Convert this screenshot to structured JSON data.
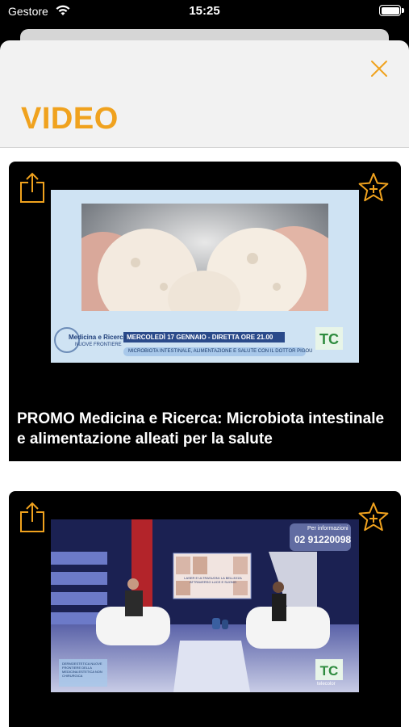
{
  "status_bar": {
    "carrier": "Gestore",
    "time": "15:25"
  },
  "header": {
    "title": "VIDEO"
  },
  "videos": [
    {
      "title": "PROMO Medicina e Ricerca: Microbiota intestinale e alimentazione alleati per la salute",
      "thumbnail": {
        "program": "Medicina e Ricerca",
        "program_sub": "NUOVE FRONTIERE",
        "date_banner": "MERCOLEDÌ 17 GENNAIO - DIRETTA ORE 21.00",
        "ticker": "MICROBIOTA INTESTINALE, ALIMENTAZIONE E SALUTE CON IL DOTTOR PIGOU",
        "logo": "TC"
      }
    },
    {
      "thumbnail": {
        "info_label": "Per informazioni",
        "phone": "02 91220098",
        "screen_text": "LASER E ULTRASUONI: LA BELLEZZA ATTRAVERSO LUCE E SUONO",
        "logo": "TC",
        "logo_sub": "telecolor",
        "program_box": "DERMOESTETICA NUOVE FRONTIERE DELLA MEDICINA ESTETICA NON CHIRURGICA"
      }
    }
  ],
  "colors": {
    "accent": "#f0a21e",
    "sheet_bg": "#f2f2f2",
    "card_bg": "#000000"
  },
  "icons": [
    "wifi-icon",
    "battery-icon",
    "close-icon",
    "share-icon",
    "star-plus-icon"
  ]
}
